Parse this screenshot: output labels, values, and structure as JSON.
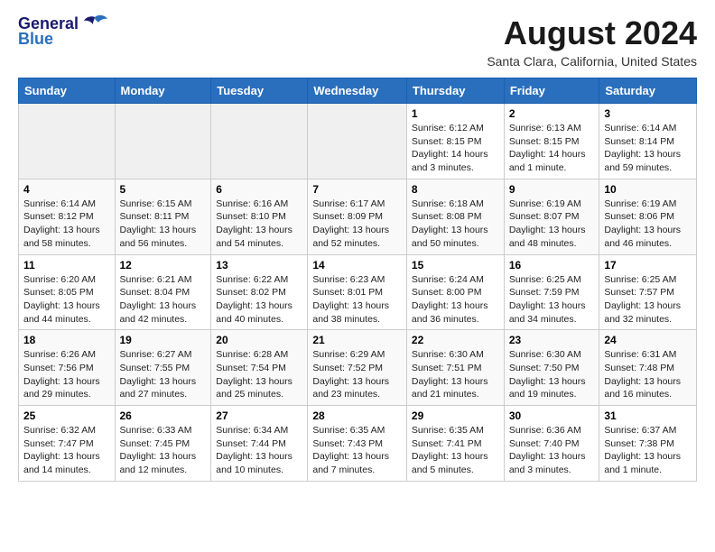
{
  "header": {
    "logo_general": "General",
    "logo_blue": "Blue",
    "month_title": "August 2024",
    "subtitle": "Santa Clara, California, United States"
  },
  "weekdays": [
    "Sunday",
    "Monday",
    "Tuesday",
    "Wednesday",
    "Thursday",
    "Friday",
    "Saturday"
  ],
  "weeks": [
    [
      {
        "day": "",
        "info": ""
      },
      {
        "day": "",
        "info": ""
      },
      {
        "day": "",
        "info": ""
      },
      {
        "day": "",
        "info": ""
      },
      {
        "day": "1",
        "info": "Sunrise: 6:12 AM\nSunset: 8:15 PM\nDaylight: 14 hours\nand 3 minutes."
      },
      {
        "day": "2",
        "info": "Sunrise: 6:13 AM\nSunset: 8:15 PM\nDaylight: 14 hours\nand 1 minute."
      },
      {
        "day": "3",
        "info": "Sunrise: 6:14 AM\nSunset: 8:14 PM\nDaylight: 13 hours\nand 59 minutes."
      }
    ],
    [
      {
        "day": "4",
        "info": "Sunrise: 6:14 AM\nSunset: 8:12 PM\nDaylight: 13 hours\nand 58 minutes."
      },
      {
        "day": "5",
        "info": "Sunrise: 6:15 AM\nSunset: 8:11 PM\nDaylight: 13 hours\nand 56 minutes."
      },
      {
        "day": "6",
        "info": "Sunrise: 6:16 AM\nSunset: 8:10 PM\nDaylight: 13 hours\nand 54 minutes."
      },
      {
        "day": "7",
        "info": "Sunrise: 6:17 AM\nSunset: 8:09 PM\nDaylight: 13 hours\nand 52 minutes."
      },
      {
        "day": "8",
        "info": "Sunrise: 6:18 AM\nSunset: 8:08 PM\nDaylight: 13 hours\nand 50 minutes."
      },
      {
        "day": "9",
        "info": "Sunrise: 6:19 AM\nSunset: 8:07 PM\nDaylight: 13 hours\nand 48 minutes."
      },
      {
        "day": "10",
        "info": "Sunrise: 6:19 AM\nSunset: 8:06 PM\nDaylight: 13 hours\nand 46 minutes."
      }
    ],
    [
      {
        "day": "11",
        "info": "Sunrise: 6:20 AM\nSunset: 8:05 PM\nDaylight: 13 hours\nand 44 minutes."
      },
      {
        "day": "12",
        "info": "Sunrise: 6:21 AM\nSunset: 8:04 PM\nDaylight: 13 hours\nand 42 minutes."
      },
      {
        "day": "13",
        "info": "Sunrise: 6:22 AM\nSunset: 8:02 PM\nDaylight: 13 hours\nand 40 minutes."
      },
      {
        "day": "14",
        "info": "Sunrise: 6:23 AM\nSunset: 8:01 PM\nDaylight: 13 hours\nand 38 minutes."
      },
      {
        "day": "15",
        "info": "Sunrise: 6:24 AM\nSunset: 8:00 PM\nDaylight: 13 hours\nand 36 minutes."
      },
      {
        "day": "16",
        "info": "Sunrise: 6:25 AM\nSunset: 7:59 PM\nDaylight: 13 hours\nand 34 minutes."
      },
      {
        "day": "17",
        "info": "Sunrise: 6:25 AM\nSunset: 7:57 PM\nDaylight: 13 hours\nand 32 minutes."
      }
    ],
    [
      {
        "day": "18",
        "info": "Sunrise: 6:26 AM\nSunset: 7:56 PM\nDaylight: 13 hours\nand 29 minutes."
      },
      {
        "day": "19",
        "info": "Sunrise: 6:27 AM\nSunset: 7:55 PM\nDaylight: 13 hours\nand 27 minutes."
      },
      {
        "day": "20",
        "info": "Sunrise: 6:28 AM\nSunset: 7:54 PM\nDaylight: 13 hours\nand 25 minutes."
      },
      {
        "day": "21",
        "info": "Sunrise: 6:29 AM\nSunset: 7:52 PM\nDaylight: 13 hours\nand 23 minutes."
      },
      {
        "day": "22",
        "info": "Sunrise: 6:30 AM\nSunset: 7:51 PM\nDaylight: 13 hours\nand 21 minutes."
      },
      {
        "day": "23",
        "info": "Sunrise: 6:30 AM\nSunset: 7:50 PM\nDaylight: 13 hours\nand 19 minutes."
      },
      {
        "day": "24",
        "info": "Sunrise: 6:31 AM\nSunset: 7:48 PM\nDaylight: 13 hours\nand 16 minutes."
      }
    ],
    [
      {
        "day": "25",
        "info": "Sunrise: 6:32 AM\nSunset: 7:47 PM\nDaylight: 13 hours\nand 14 minutes."
      },
      {
        "day": "26",
        "info": "Sunrise: 6:33 AM\nSunset: 7:45 PM\nDaylight: 13 hours\nand 12 minutes."
      },
      {
        "day": "27",
        "info": "Sunrise: 6:34 AM\nSunset: 7:44 PM\nDaylight: 13 hours\nand 10 minutes."
      },
      {
        "day": "28",
        "info": "Sunrise: 6:35 AM\nSunset: 7:43 PM\nDaylight: 13 hours\nand 7 minutes."
      },
      {
        "day": "29",
        "info": "Sunrise: 6:35 AM\nSunset: 7:41 PM\nDaylight: 13 hours\nand 5 minutes."
      },
      {
        "day": "30",
        "info": "Sunrise: 6:36 AM\nSunset: 7:40 PM\nDaylight: 13 hours\nand 3 minutes."
      },
      {
        "day": "31",
        "info": "Sunrise: 6:37 AM\nSunset: 7:38 PM\nDaylight: 13 hours\nand 1 minute."
      }
    ]
  ]
}
